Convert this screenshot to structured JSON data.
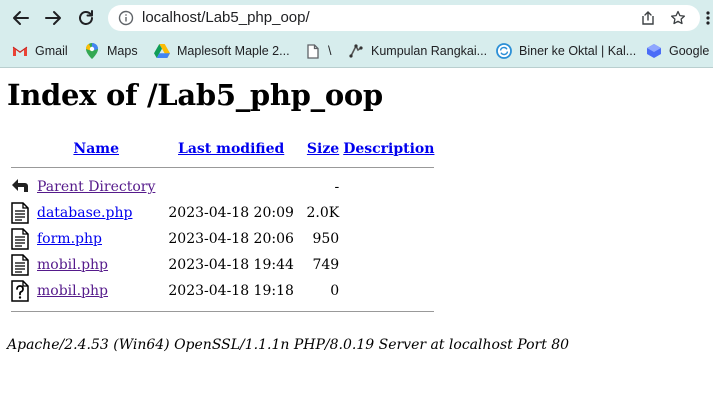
{
  "browser": {
    "url": "localhost/Lab5_php_oop/",
    "bookmarks": [
      {
        "label": "Gmail",
        "icon": "gmail-icon"
      },
      {
        "label": "Maps",
        "icon": "maps-icon"
      },
      {
        "label": "Maplesoft Maple 2...",
        "icon": "drive-icon"
      },
      {
        "label": "\\",
        "icon": "document-icon"
      },
      {
        "label": "Kumpulan Rangkai...",
        "icon": "circuit-icon"
      },
      {
        "label": "Biner ke Oktal | Kal...",
        "icon": "converter-icon"
      },
      {
        "label": "Google C",
        "icon": "google-icon"
      }
    ]
  },
  "page": {
    "title": "Index of /Lab5_php_oop",
    "columns": {
      "name": "Name",
      "last_modified": "Last modified",
      "size": "Size",
      "description": "Description"
    },
    "parent": {
      "name": "Parent Directory",
      "size": "-",
      "icon": "back-icon"
    },
    "files": [
      {
        "name": "database.php",
        "modified": "2023-04-18 20:09",
        "size": "2.0K",
        "icon": "text-file-icon"
      },
      {
        "name": "form.php",
        "modified": "2023-04-18 20:06",
        "size": "950",
        "icon": "text-file-icon"
      },
      {
        "name": "mobil.php",
        "modified": "2023-04-18 19:44",
        "size": "749",
        "icon": "text-file-icon"
      },
      {
        "name": "mobil.php",
        "modified": "2023-04-18 19:18",
        "size": "0",
        "icon": "unknown-file-icon"
      }
    ],
    "footer": "Apache/2.4.53 (Win64) OpenSSL/1.1.1n PHP/8.0.19 Server at localhost Port 80"
  }
}
